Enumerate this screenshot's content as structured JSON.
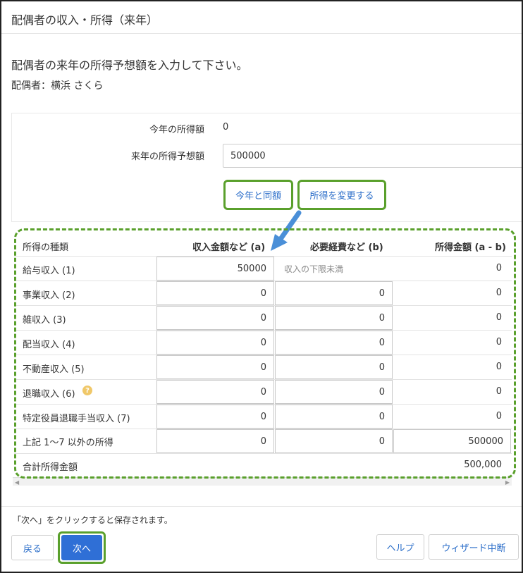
{
  "header": {
    "title": "配偶者の収入・所得（来年）"
  },
  "instruction": "配偶者の来年の所得予想額を入力して下さい。",
  "spouse": {
    "label": "配偶者：",
    "name": "横浜 さくら"
  },
  "form": {
    "this_year_label": "今年の所得額",
    "this_year_value": "0",
    "next_year_label": "来年の所得予想額",
    "next_year_value": "500000"
  },
  "actions": {
    "same_as_this_year": "今年と同額",
    "change_income": "所得を変更する"
  },
  "table": {
    "headers": [
      "所得の種類",
      "収入金額など (a)",
      "必要経費など (b)",
      "所得金額 (a - b)"
    ],
    "rows": [
      {
        "label": "給与収入 (1)",
        "a": "50000",
        "b": "収入の下限未満",
        "c": "0"
      },
      {
        "label": "事業収入 (2)",
        "a": "0",
        "b": "0",
        "c": "0"
      },
      {
        "label": "雑収入 (3)",
        "a": "0",
        "b": "0",
        "c": "0"
      },
      {
        "label": "配当収入 (4)",
        "a": "0",
        "b": "0",
        "c": "0"
      },
      {
        "label": "不動産収入 (5)",
        "a": "0",
        "b": "0",
        "c": "0"
      },
      {
        "label": "退職収入 (6)",
        "a": "0",
        "b": "0",
        "c": "0"
      },
      {
        "label": "特定役員退職手当収入 (7)",
        "a": "0",
        "b": "0",
        "c": "0"
      },
      {
        "label": "上記 1〜7 以外の所得",
        "a": "0",
        "b": "0",
        "c": "500000"
      }
    ],
    "total_label": "合計所得金額",
    "total_value": "500,000",
    "help_glyph": "?"
  },
  "footer": {
    "note": "「次へ」をクリックすると保存されます。",
    "back": "戻る",
    "next": "次へ",
    "help": "ヘルプ",
    "abort": "ウィザード中断"
  },
  "colors": {
    "accent": "#2f6fd6",
    "highlight": "#5aa02c",
    "arrow": "#4a8fd8"
  }
}
